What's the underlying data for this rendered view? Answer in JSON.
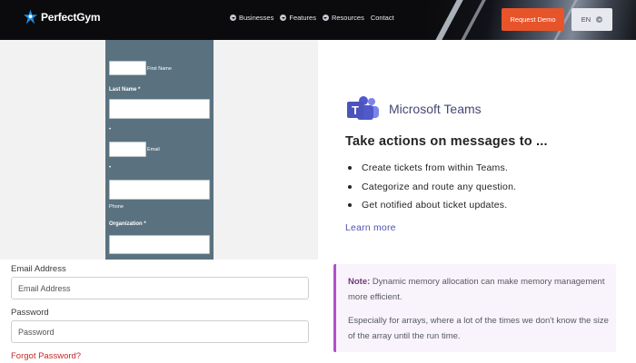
{
  "header": {
    "brand": "PerfectGym",
    "nav": [
      {
        "label": "Businesses"
      },
      {
        "label": "Features"
      },
      {
        "label": "Resources"
      },
      {
        "label": "Contact"
      }
    ],
    "cta_label": "Request Demo",
    "language": "EN",
    "colors": {
      "cta": "#e8542a",
      "bar": "#0b0b0d"
    }
  },
  "signup_form": {
    "first_name_label": "First Name",
    "last_name_label": "Last Name *",
    "email_label": "Email",
    "phone_label": "Phone",
    "organization_label": "Organization *",
    "marker": "•",
    "panel_color": "#5a7280"
  },
  "teams_card": {
    "app_name": "Microsoft Teams",
    "heading": "Take actions on messages to ...",
    "bullets": [
      "Create tickets from within Teams.",
      "Categorize and route any question.",
      "Get notified about ticket updates."
    ],
    "link": "Learn more",
    "icon": "microsoft-teams-icon"
  },
  "login": {
    "email_label": "Email Address",
    "email_placeholder": "Email Address",
    "password_label": "Password",
    "password_placeholder": "Password",
    "forgot_link": "Forgot Password?"
  },
  "note": {
    "label": "Note:",
    "text": " Dynamic memory allocation can make memory management more efficient.",
    "text2": "Especially for arrays, where a lot of the times we don't know the size of the array until the run time.",
    "accent": "#b251c9"
  }
}
